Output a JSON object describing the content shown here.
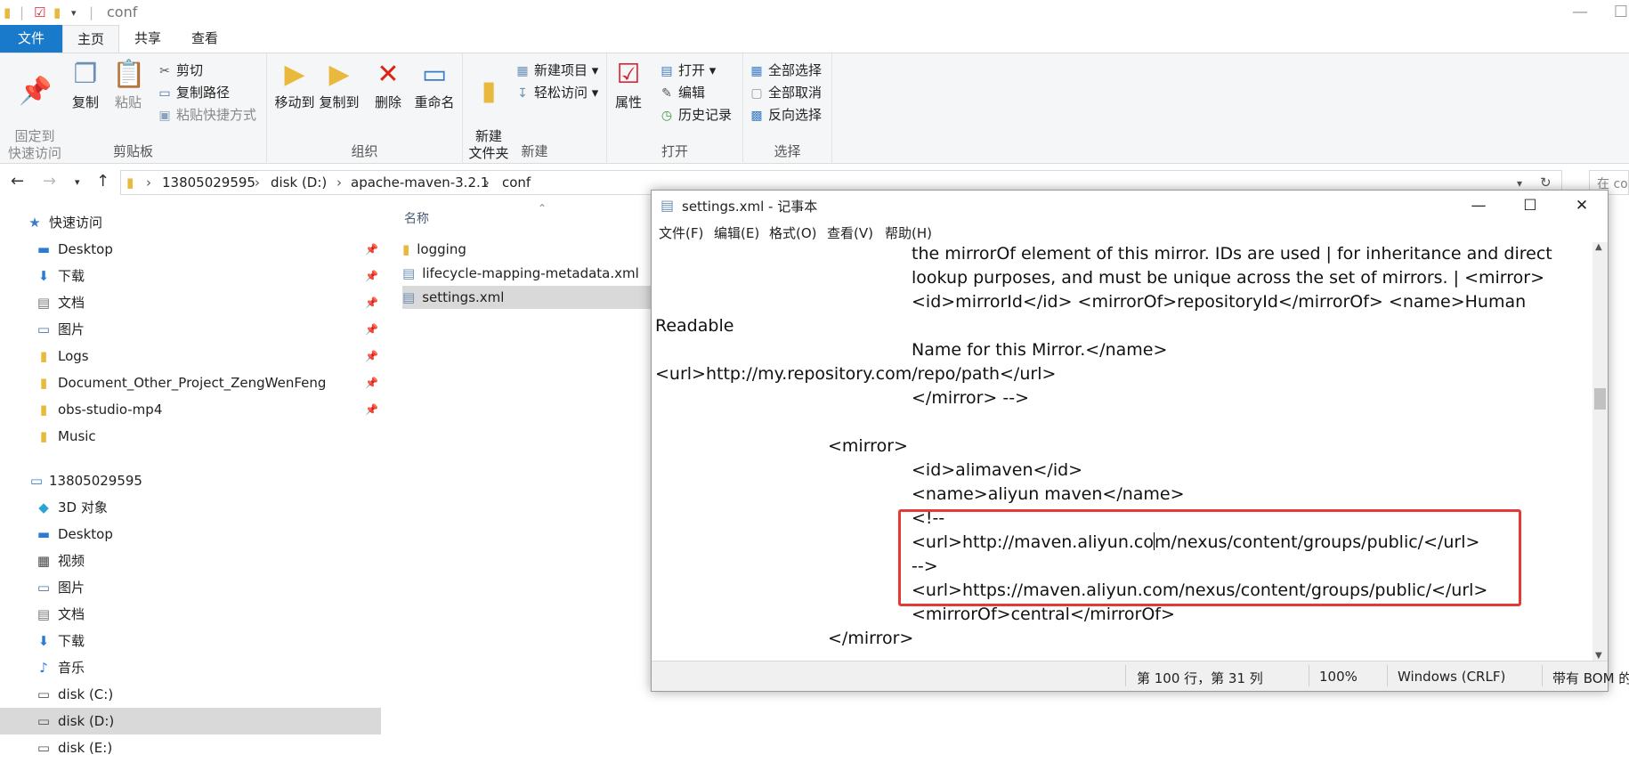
{
  "explorer": {
    "title": "conf",
    "tabs": {
      "file": "文件",
      "home": "主页",
      "share": "共享",
      "view": "查看"
    },
    "ribbon": {
      "clipboard": {
        "label": "剪贴板",
        "pin": "固定到\n快速访问",
        "copy": "复制",
        "paste": "粘贴",
        "cut": "剪切",
        "copy_path": "复制路径",
        "paste_shortcut": "粘贴快捷方式"
      },
      "organize": {
        "label": "组织",
        "move_to": "移动到",
        "copy_to": "复制到",
        "delete": "删除",
        "rename": "重命名"
      },
      "new": {
        "label": "新建",
        "new_folder": "新建\n文件夹",
        "new_item": "新建项目",
        "easy_access": "轻松访问"
      },
      "open": {
        "label": "打开",
        "properties": "属性",
        "open": "打开",
        "edit": "编辑",
        "history": "历史记录"
      },
      "select": {
        "label": "选择",
        "select_all": "全部选择",
        "select_none": "全部取消",
        "invert": "反向选择"
      }
    },
    "address": {
      "crumbs": [
        "13805029595",
        "disk (D:)",
        "apache-maven-3.2.1",
        "conf"
      ],
      "search_placeholder": "在 co"
    },
    "nav": {
      "quick_access": "快速访问",
      "quick_items": [
        "Desktop",
        "下载",
        "文档",
        "图片",
        "Logs",
        "Document_Other_Project_ZengWenFeng",
        "obs-studio-mp4",
        "Music"
      ],
      "this_pc": "13805029595",
      "pc_items": [
        "3D 对象",
        "Desktop",
        "视频",
        "图片",
        "文档",
        "下载",
        "音乐",
        "disk (C:)",
        "disk (D:)",
        "disk (E:)"
      ]
    },
    "files": {
      "column_name": "名称",
      "items": [
        "logging",
        "lifecycle-mapping-metadata.xml",
        "settings.xml"
      ]
    }
  },
  "notepad": {
    "title": "settings.xml - 记事本",
    "menu": [
      "文件(F)",
      "编辑(E)",
      "格式(O)",
      "查看(V)",
      "帮助(H)"
    ],
    "lines": [
      "the mirrorOf element of this mirror. IDs are used | for inheritance and direct",
      "lookup purposes, and must be unique across the set of mirrors. | <mirror>",
      "<id>mirrorId</id> <mirrorOf>repositoryId</mirrorOf> <name>Human",
      "Readable",
      "Name for this Mirror.</name>",
      "<url>http://my.repository.com/repo/path</url>",
      "</mirror> -->",
      "",
      "<mirror>",
      "<id>alimaven</id>",
      "<name>aliyun maven</name>",
      "<!--",
      "<url>http://maven.aliyun.co",
      "m/nexus/content/groups/public/</url>",
      "-->",
      "<url>https://maven.aliyun.com/nexus/content/groups/public/</url>",
      "<mirrorOf>central</mirrorOf>",
      "</mirror>"
    ],
    "status": {
      "position": "第 100 行，第 31 列",
      "zoom": "100%",
      "line_ending": "Windows (CRLF)",
      "encoding": "带有 BOM 的 UTF"
    }
  }
}
